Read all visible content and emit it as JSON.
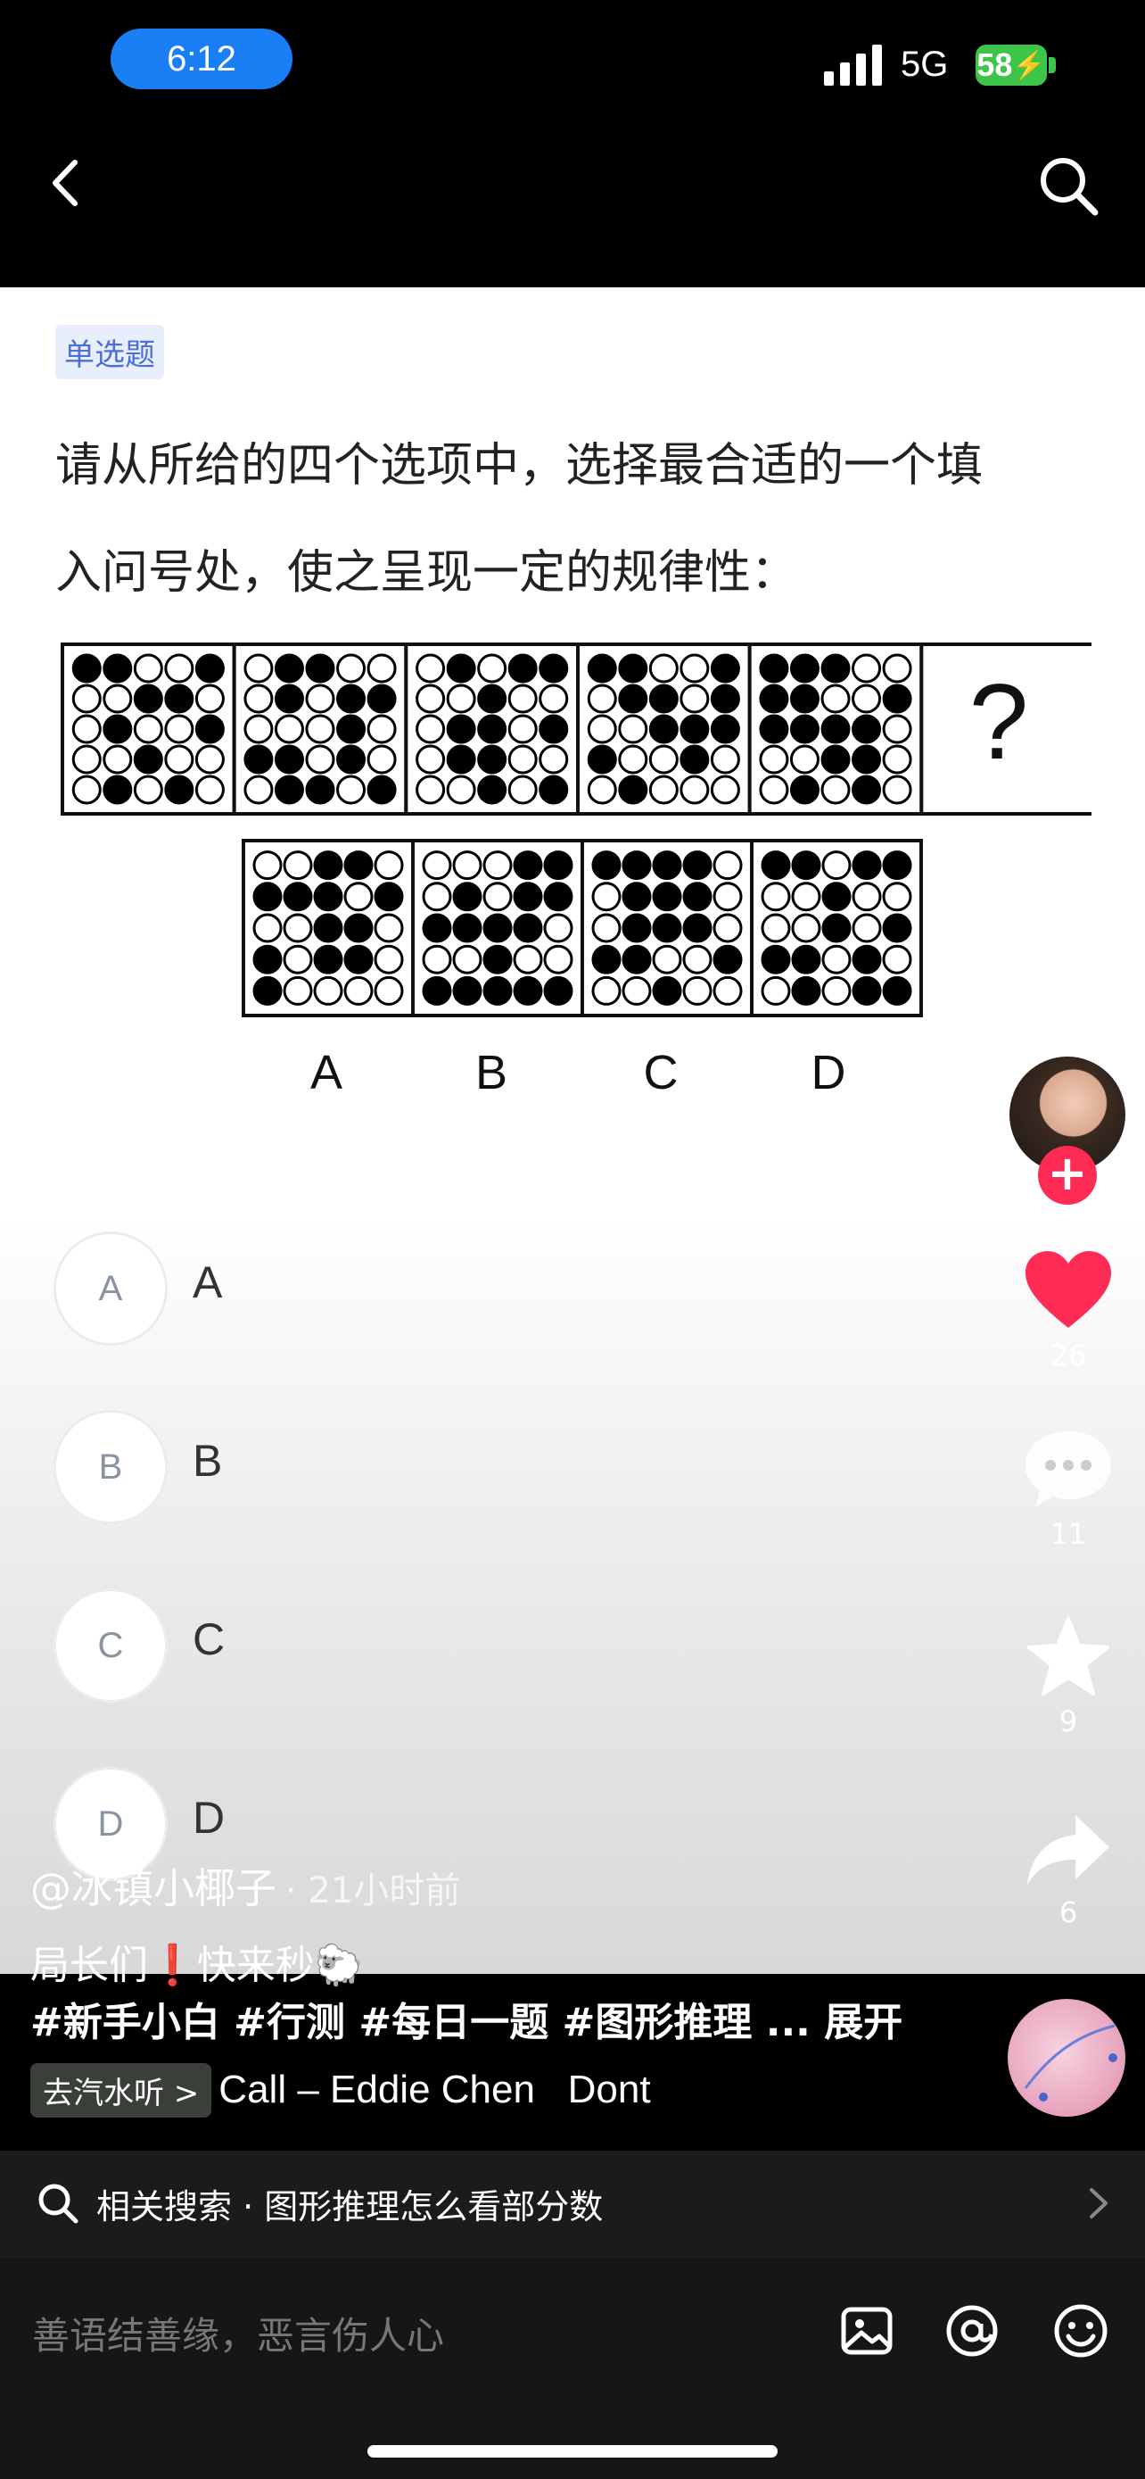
{
  "status": {
    "time": "6:12",
    "network": "5G",
    "battery": "58"
  },
  "question": {
    "tag": "单选题",
    "text_line1": "请从所给的四个选项中，选择最合适的一个填",
    "text_line2": "入问号处，使之呈现一定的规律性：",
    "figure": {
      "question_mark": "?",
      "option_letters": [
        "A",
        "B",
        "C",
        "D"
      ]
    },
    "options": [
      {
        "letter": "A",
        "label": "A"
      },
      {
        "letter": "B",
        "label": "B"
      },
      {
        "letter": "C",
        "label": "C"
      },
      {
        "letter": "D",
        "label": "D"
      }
    ]
  },
  "rail": {
    "likes": "26",
    "comments": "11",
    "favorites": "9",
    "shares": "6"
  },
  "post": {
    "author": "@冰镇小椰子",
    "time": "· 21小时前",
    "caption": "局长们❗快来秒🐑",
    "tags": "#新手小白 #行测 #每日一题 #图形推理 ... 展开",
    "music_pill": "去汽水听 >",
    "music_text": "Call – Eddie Chen   Dont"
  },
  "related": {
    "text": "相关搜索 · 图形推理怎么看部分数"
  },
  "comment_bar": {
    "placeholder": "善语结善缘，恶言伤人心"
  },
  "colors": {
    "like": "#fe2c55",
    "time_pill": "#1a7ef5",
    "battery": "#3fc44a"
  }
}
